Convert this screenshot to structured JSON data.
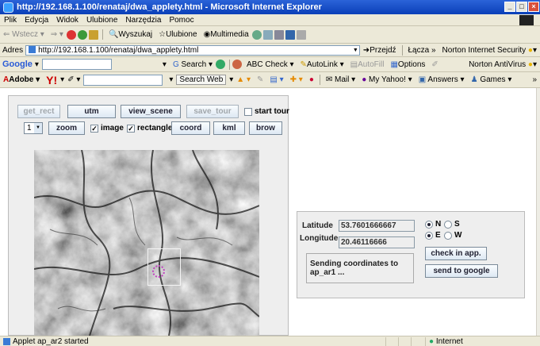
{
  "window": {
    "title": "http://192.168.1.100/renataj/dwa_applety.html - Microsoft Internet Explorer"
  },
  "menu": [
    "Plik",
    "Edycja",
    "Widok",
    "Ulubione",
    "Narzędzia",
    "Pomoc"
  ],
  "toolbar": {
    "back": "Wstecz",
    "search": "Wyszukaj",
    "favorites": "Ulubione",
    "multimedia": "Multimedia"
  },
  "address": {
    "label": "Adres",
    "url": "http://192.168.1.100/renataj/dwa_applety.html",
    "go": "Przejdź",
    "links": "Łącza",
    "norton": "Norton Internet Security"
  },
  "google_bar": {
    "logo": "Google",
    "search": "Search",
    "check": "Check",
    "autolink": "AutoLink",
    "autofill": "AutoFill",
    "options": "Options",
    "antivirus": "Norton AntiVirus"
  },
  "yahoo_bar": {
    "adobe": "Adobe",
    "yahoo": "Y!",
    "search_web": "Search Web",
    "mail": "Mail",
    "my_yahoo": "My Yahoo!",
    "answers": "Answers",
    "games": "Games"
  },
  "applet": {
    "buttons": {
      "get_rect": "get_rect",
      "utm": "utm",
      "view_scene": "view_scene",
      "save_tour": "save_tour",
      "zoom": "zoom",
      "coord": "coord",
      "kml": "kml",
      "brow": "brow"
    },
    "start_tour": {
      "label": "start tour",
      "checked": false
    },
    "zoom_level": "1",
    "image": {
      "label": "image",
      "checked": true
    },
    "rectangle": {
      "label": "rectangle",
      "checked": true
    }
  },
  "coords": {
    "latitude_label": "Latitude",
    "latitude": "53.7601666667",
    "longitude_label": "Longitude",
    "longitude": "20.46116666",
    "n": "N",
    "s": "S",
    "e": "E",
    "w": "W",
    "lat_dir": "N",
    "lon_dir": "E",
    "check_in_app": "check in app.",
    "send_to_google": "send to google",
    "status": "Sending coordinates to  ap_ar1 ..."
  },
  "status": {
    "text": "Applet ap_ar2 started",
    "zone": "Internet"
  },
  "colors": {
    "title_blue": "#0a3fb8",
    "chrome": "#ece9d8",
    "map_gray": "#8a8a8a"
  }
}
